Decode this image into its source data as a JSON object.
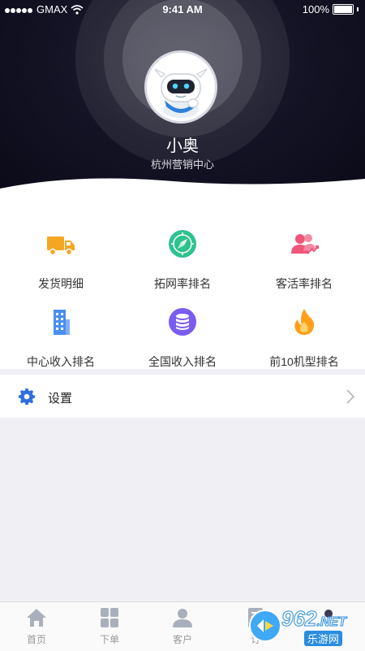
{
  "status_bar": {
    "carrier": "GMAX",
    "time": "9:41 AM",
    "battery": "100%"
  },
  "profile": {
    "name": "小奥",
    "department": "杭州营销中心",
    "avatar_icon": "robot-mascot-avatar"
  },
  "menu": [
    {
      "label": "发货明细",
      "icon": "truck-icon",
      "color": "#f5a623"
    },
    {
      "label": "拓网率排名",
      "icon": "compass-icon",
      "color": "#2ec28f"
    },
    {
      "label": "客活率排名",
      "icon": "users-trend-icon",
      "color": "#f0557a"
    },
    {
      "label": "中心收入排名",
      "icon": "building-icon",
      "color": "#4a8ef0"
    },
    {
      "label": "全国收入排名",
      "icon": "database-icon",
      "color": "#7b5cf0"
    },
    {
      "label": "前10机型排名",
      "icon": "flame-icon",
      "color": "#ff9f1a"
    }
  ],
  "settings": {
    "label": "设置",
    "icon": "gear-icon",
    "color": "#2f6fde"
  },
  "tabs": [
    {
      "label": "首页",
      "icon": "home-icon"
    },
    {
      "label": "下单",
      "icon": "grid-icon"
    },
    {
      "label": "客户",
      "icon": "customer-icon"
    },
    {
      "label": "订",
      "icon": "order-icon"
    }
  ],
  "watermark": {
    "text": "962",
    "suffix": ".NET",
    "sub": "乐游网"
  }
}
